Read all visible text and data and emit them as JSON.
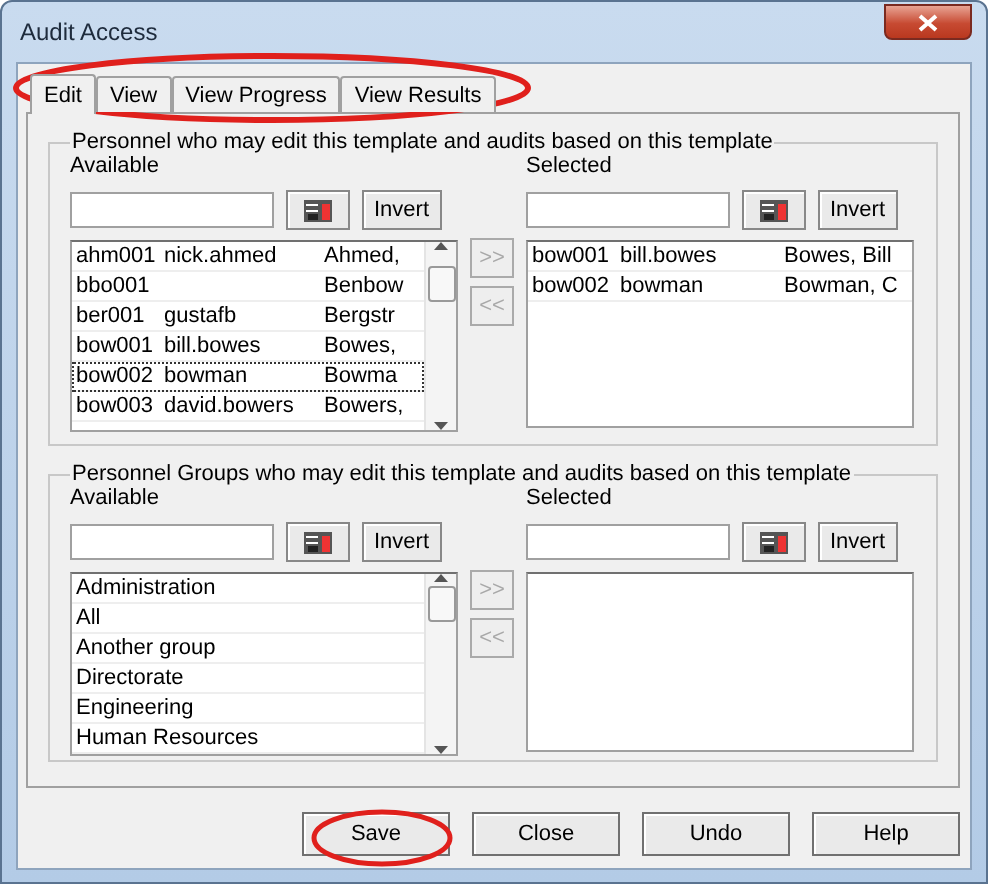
{
  "window": {
    "title": "Audit Access"
  },
  "tabs": [
    {
      "label": "Edit",
      "selected": true
    },
    {
      "label": "View",
      "selected": false
    },
    {
      "label": "View Progress",
      "selected": false
    },
    {
      "label": "View Results",
      "selected": false
    }
  ],
  "personnel": {
    "legend": "Personnel who may edit this template and audits based on this template",
    "available": {
      "label": "Available",
      "invert": "Invert",
      "rows": [
        {
          "id": "ahm001",
          "login": "nick.ahmed",
          "name": "Ahmed,",
          "focused": false
        },
        {
          "id": "bbo001",
          "name": "Benbow",
          "focused": false
        },
        {
          "id": "ber001",
          "login": "gustafb",
          "name": "Bergstr",
          "focused": false
        },
        {
          "id": "bow001",
          "login": "bill.bowes",
          "name": "Bowes,",
          "focused": false
        },
        {
          "id": "bow002",
          "login": "bowman",
          "name": "Bowma",
          "focused": true
        },
        {
          "id": "bow003",
          "login": "david.bowers",
          "name": "Bowers,",
          "focused": false
        }
      ]
    },
    "add": {
      "label": ">>",
      "disabled": true
    },
    "remove": {
      "label": "<<",
      "disabled": true
    },
    "selected": {
      "label": "Selected",
      "invert": "Invert",
      "rows": [
        {
          "id": "bow001",
          "login": "bill.bowes",
          "name": "Bowes, Bill",
          "focused": false
        },
        {
          "id": "bow002",
          "login": "bowman",
          "name": "Bowman, C",
          "focused": false
        }
      ]
    }
  },
  "groups": {
    "legend": "Personnel Groups who may edit this template and audits based on this template",
    "available": {
      "label": "Available",
      "invert": "Invert",
      "rows": [
        {
          "name": "Administration",
          "focused": false
        },
        {
          "name": "All",
          "focused": false
        },
        {
          "name": "Another group",
          "focused": false
        },
        {
          "name": "Directorate",
          "focused": false
        },
        {
          "name": "Engineering",
          "focused": false
        },
        {
          "name": "Human Resources",
          "focused": false
        }
      ]
    },
    "add": {
      "label": ">>",
      "disabled": true
    },
    "remove": {
      "label": "<<",
      "disabled": true
    },
    "selected": {
      "label": "Selected",
      "invert": "Invert"
    }
  },
  "buttons": [
    {
      "label": "Save"
    },
    {
      "label": "Close"
    },
    {
      "label": "Undo"
    },
    {
      "label": "Help"
    }
  ]
}
